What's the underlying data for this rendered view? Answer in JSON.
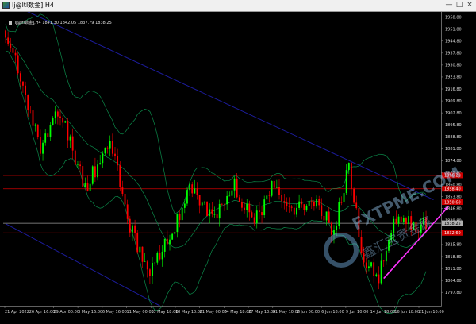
{
  "window": {
    "title": "Ij@ltl数金],H4",
    "app_icon": "terminal-chart-icon",
    "controls": {
      "minimize": "—",
      "maximize": "□",
      "close": "×"
    }
  },
  "symbol_header": {
    "symbol": "Ij@ltl数金],H4",
    "ohlc": "1841.30 1842.05 1837.79 1838.25"
  },
  "colors": {
    "background": "#000000",
    "bull_candle": "#00ff00",
    "bear_candle": "#ff0000",
    "bands": "#0b8a4a",
    "channel": "#1c1c9c",
    "level_lines": "#cc0000",
    "arrow": "#ff33ff",
    "axis_text": "#d8d8d8"
  },
  "price_axis": {
    "min": 1790,
    "max": 1960,
    "labels": [
      "1958.80",
      "1951.80",
      "1944.80",
      "1937.80",
      "1930.80",
      "1923.80",
      "1916.80",
      "1909.80",
      "1902.80",
      "1895.80",
      "1888.80",
      "1881.80",
      "1874.80",
      "1867.80",
      "1860.80",
      "1853.80",
      "1846.80",
      "1839.80",
      "1832.80",
      "1825.80",
      "1818.80",
      "1811.80",
      "1804.80",
      "1797.80",
      "1790.80"
    ],
    "level_tags": [
      {
        "price": 1866.2,
        "text": "1866.20"
      },
      {
        "price": 1858.4,
        "text": "1858.40"
      },
      {
        "price": 1850.6,
        "text": "1850.60"
      },
      {
        "price": 1832.6,
        "text": "1832.60"
      }
    ],
    "current_price": {
      "price": 1838.25,
      "text": "1838.25"
    }
  },
  "time_axis": {
    "labels": [
      "21 Apr 2022",
      "26 Apr 16:00",
      "29 Apr 00:00",
      "3 May 16:00",
      "6 May 16:00",
      "11 May 00:00",
      "13 May 18:00",
      "18 May 10:00",
      "21 May 00:00",
      "24 May 18:00",
      "27 May 10:00",
      "31 May 10:00",
      "2 Jun 00:00",
      "6 Jun 18:00",
      "9 Jun 10:00",
      "14 Jun 18:00",
      "16 Jun 18:00",
      "21 Jun 10:00"
    ]
  },
  "levels": [
    1866.2,
    1858.4,
    1850.6,
    1838.25,
    1832.6
  ],
  "channel": [
    {
      "from_bar": 0,
      "from_price": 1968,
      "to_bar": 172,
      "to_price": 1852
    },
    {
      "from_bar": 0,
      "from_price": 1838,
      "to_bar": 62,
      "to_price": 1790
    }
  ],
  "arrow": {
    "from_bar": 152,
    "from_price": 1806,
    "to_bar": 178,
    "to_price": 1848
  },
  "bars": {
    "count": 170,
    "start_price": 1951,
    "seed": 20220421
  },
  "watermark": {
    "text": "FXTPME.COM",
    "subtext": "鑫汇宝贵金属",
    "logo": "fxtpme-logo"
  }
}
